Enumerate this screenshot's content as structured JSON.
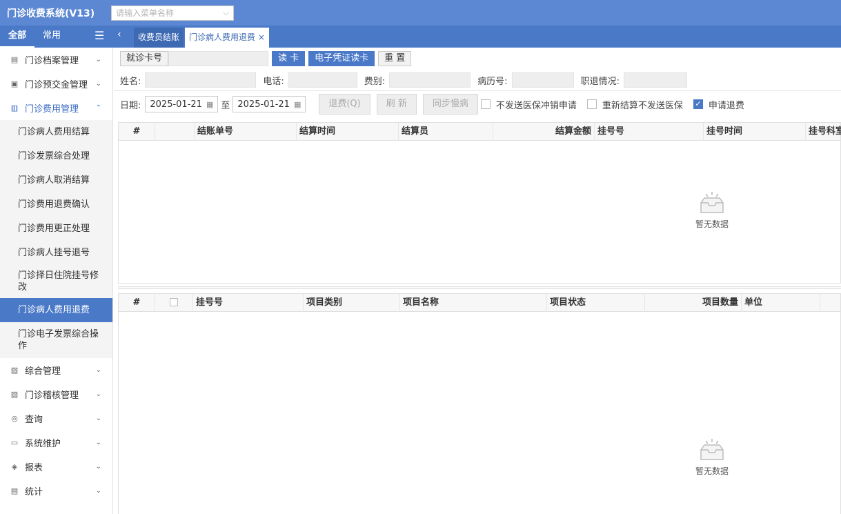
{
  "app": {
    "title": "门诊收费系统(V13)",
    "search_placeholder": "请输入菜单名称"
  },
  "side_tabs": [
    "全部",
    "常用"
  ],
  "page_tabs": [
    {
      "label": "收费员结账"
    },
    {
      "label": "门诊病人费用退费",
      "close": "×"
    }
  ],
  "sidebar": {
    "groups": [
      {
        "label": "门诊档案管理",
        "icon": "file-icon"
      },
      {
        "label": "门诊预交金管理",
        "icon": "wallet-icon"
      },
      {
        "label": "门诊费用管理",
        "icon": "receipt-icon"
      }
    ],
    "fee_subitems": [
      "门诊病人费用结算",
      "门诊发票综合处理",
      "门诊病人取消结算",
      "门诊费用退费确认",
      "门诊费用更正处理",
      "门诊病人挂号退号",
      "门诊择日住院挂号修改",
      "门诊病人费用退费",
      "门诊电子发票综合操作"
    ],
    "active_subitem": "门诊病人费用退费",
    "more_groups": [
      {
        "label": "综合管理",
        "icon": "folder-icon"
      },
      {
        "label": "门诊稽核管理",
        "icon": "audit-icon"
      },
      {
        "label": "查询",
        "icon": "search-icon"
      },
      {
        "label": "系统维护",
        "icon": "monitor-icon"
      },
      {
        "label": "报表",
        "icon": "report-icon"
      },
      {
        "label": "统计",
        "icon": "stats-icon"
      }
    ]
  },
  "toolbar": {
    "card_label": "就诊卡号",
    "read_card": "读 卡",
    "ecard_read": "电子凭证读卡",
    "reset": "重 置"
  },
  "patient": {
    "name_label": "姓名:",
    "phone_label": "电话:",
    "fee_type_label": "费别:",
    "record_label": "病历号:",
    "status_label": "职退情况:"
  },
  "filter": {
    "date_label": "日期:",
    "date_from": "2025-01-21",
    "to_label": "至",
    "date_to": "2025-01-21",
    "refund": "退费(Q)",
    "refresh": "刷 新",
    "sync": "同步慢病",
    "opt1": "不发送医保冲销申请",
    "opt2": "重新结算不发送医保",
    "opt3": "申请退费",
    "opt3_checked": true
  },
  "grid1": {
    "columns": [
      "#",
      "",
      "结账单号",
      "结算时间",
      "结算员",
      "结算金额",
      "挂号号",
      "挂号时间",
      "挂号科室"
    ]
  },
  "grid2": {
    "columns": [
      "#",
      "",
      "挂号号",
      "项目类别",
      "项目名称",
      "项目状态",
      "项目数量",
      "单位",
      ""
    ]
  },
  "empty_text": "暂无数据"
}
